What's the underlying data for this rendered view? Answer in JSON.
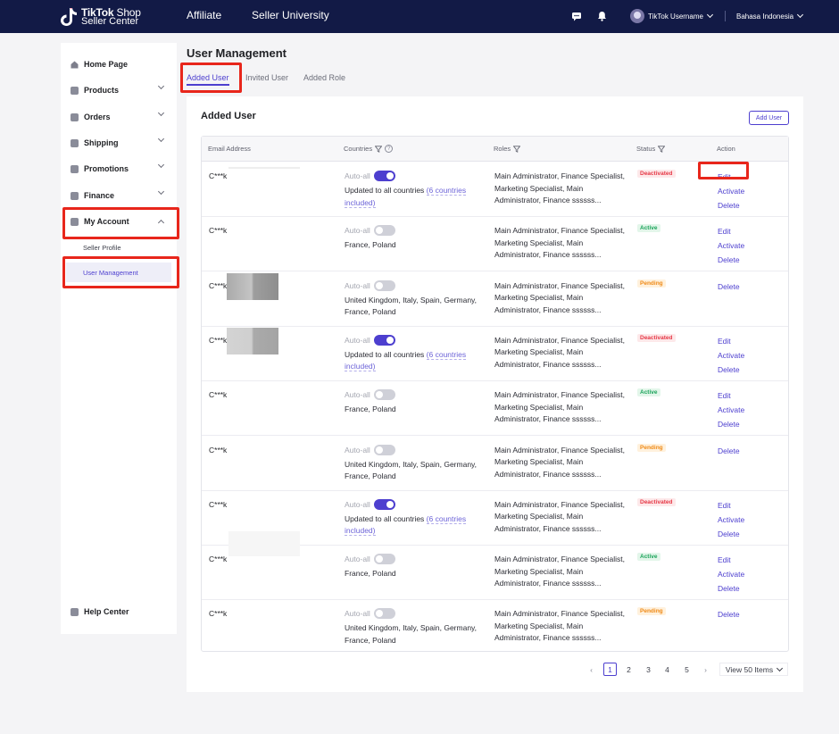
{
  "header": {
    "brand_line1": "TikTok",
    "brand_line1b": "Shop",
    "brand_line2": "Seller Center",
    "nav": [
      "Affiliate",
      "Seller University"
    ],
    "username": "TikTok Username",
    "language": "Bahasa Indonesia"
  },
  "sidebar": {
    "items": [
      {
        "label": "Home Page",
        "icon": "home-icon"
      },
      {
        "label": "Products",
        "icon": "box-icon"
      },
      {
        "label": "Orders",
        "icon": "document-icon"
      },
      {
        "label": "Shipping",
        "icon": "truck-icon"
      },
      {
        "label": "Promotions",
        "icon": "megaphone-icon"
      },
      {
        "label": "Finance",
        "icon": "card-icon"
      },
      {
        "label": "My Account",
        "icon": "account-icon"
      }
    ],
    "sub_items": [
      "Seller Profile",
      "User Management"
    ],
    "help": "Help Center"
  },
  "page": {
    "title": "User Management",
    "tabs": [
      "Added User",
      "Invited User",
      "Added Role"
    ],
    "panel_title": "Added User",
    "add_user_button": "Add User"
  },
  "table": {
    "headers": {
      "email": "Email Address",
      "countries": "Countries",
      "roles": "Roles",
      "status": "Status",
      "action": "Action"
    },
    "auto_all_label": "Auto-all",
    "rows": [
      {
        "email": "C***k",
        "auto_all": true,
        "countries_prefix": "Updated to all countries ",
        "countries_link": "(6 countries included)",
        "countries": "",
        "roles": "Main Administrator, Finance Specialist, Marketing Specialist, Main Administrator, Finance ssssss...",
        "status": "Deactivated",
        "actions": [
          "Edit",
          "Activate",
          "Delete"
        ]
      },
      {
        "email": "C***k",
        "auto_all": false,
        "countries_prefix": "",
        "countries_link": "",
        "countries": "France, Poland",
        "roles": "Main Administrator, Finance Specialist, Marketing Specialist, Main Administrator, Finance ssssss...",
        "status": "Active",
        "actions": [
          "Edit",
          "Activate",
          "Delete"
        ]
      },
      {
        "email": "C***k",
        "auto_all": false,
        "countries_prefix": "",
        "countries_link": "",
        "countries": "United Kingdom, Italy, Spain, Germany, France, Poland",
        "roles": "Main Administrator, Finance Specialist, Marketing Specialist, Main Administrator, Finance ssssss...",
        "status": "Pending",
        "actions": [
          "Delete"
        ]
      },
      {
        "email": "C***k",
        "auto_all": true,
        "countries_prefix": "Updated to all countries ",
        "countries_link": "(6 countries included)",
        "countries": "",
        "roles": "Main Administrator, Finance Specialist, Marketing Specialist, Main Administrator, Finance ssssss...",
        "status": "Deactivated",
        "actions": [
          "Edit",
          "Activate",
          "Delete"
        ]
      },
      {
        "email": "C***k",
        "auto_all": false,
        "countries_prefix": "",
        "countries_link": "",
        "countries": "France, Poland",
        "roles": "Main Administrator, Finance Specialist, Marketing Specialist, Main Administrator, Finance ssssss...",
        "status": "Active",
        "actions": [
          "Edit",
          "Activate",
          "Delete"
        ]
      },
      {
        "email": "C***k",
        "auto_all": false,
        "countries_prefix": "",
        "countries_link": "",
        "countries": "United Kingdom, Italy, Spain, Germany, France, Poland",
        "roles": "Main Administrator, Finance Specialist, Marketing Specialist, Main Administrator, Finance ssssss...",
        "status": "Pending",
        "actions": [
          "Delete"
        ]
      },
      {
        "email": "C***k",
        "auto_all": true,
        "countries_prefix": "Updated to all countries ",
        "countries_link": "(6 countries included)",
        "countries": "",
        "roles": "Main Administrator, Finance Specialist, Marketing Specialist, Main Administrator, Finance ssssss...",
        "status": "Deactivated",
        "actions": [
          "Edit",
          "Activate",
          "Delete"
        ]
      },
      {
        "email": "C***k",
        "auto_all": false,
        "countries_prefix": "",
        "countries_link": "",
        "countries": "France, Poland",
        "roles": "Main Administrator, Finance Specialist, Marketing Specialist, Main Administrator, Finance ssssss...",
        "status": "Active",
        "actions": [
          "Edit",
          "Activate",
          "Delete"
        ]
      },
      {
        "email": "C***k",
        "auto_all": false,
        "countries_prefix": "",
        "countries_link": "",
        "countries": "United Kingdom, Italy, Spain, Germany, France, Poland",
        "roles": "Main Administrator, Finance Specialist, Marketing Specialist, Main Administrator, Finance ssssss...",
        "status": "Pending",
        "actions": [
          "Delete"
        ]
      }
    ]
  },
  "pagination": {
    "prev": "‹",
    "next": "›",
    "pages": [
      "1",
      "2",
      "3",
      "4",
      "5"
    ],
    "current": "1",
    "page_size": "View 50 Items"
  },
  "colors": {
    "topbar": "#121a46",
    "accent": "#4d3fcf",
    "highlight": "#e8261b"
  }
}
